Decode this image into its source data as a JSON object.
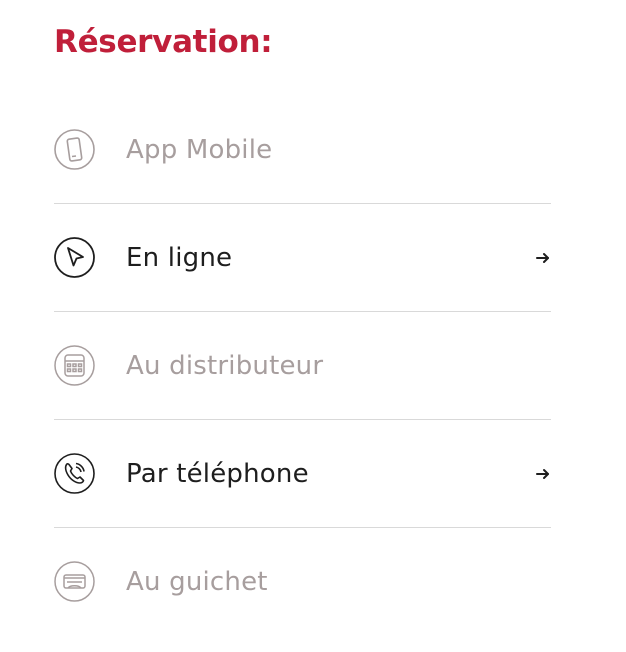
{
  "title": "Réservation:",
  "items": [
    {
      "label": "App Mobile",
      "icon": "mobile-phone-icon",
      "state": "disabled"
    },
    {
      "label": "En ligne",
      "icon": "cursor-pointer-icon",
      "state": "active"
    },
    {
      "label": "Au distributeur",
      "icon": "ticket-machine-icon",
      "state": "disabled"
    },
    {
      "label": "Par téléphone",
      "icon": "telephone-icon",
      "state": "active"
    },
    {
      "label": "Au guichet",
      "icon": "ticket-counter-icon",
      "state": "disabled"
    }
  ],
  "colors": {
    "title": "#c01f3a",
    "active_text": "#1e1e1e",
    "disabled_text": "#a79e9e",
    "divider": "#d9d9d9"
  }
}
